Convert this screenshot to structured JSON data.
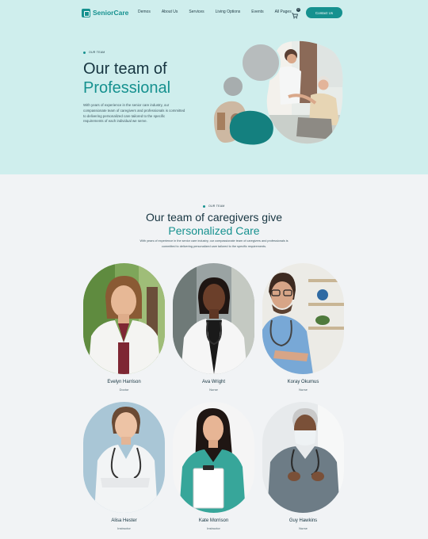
{
  "header": {
    "logo_text": "SeniorCare",
    "nav": [
      "Demos",
      "About Us",
      "Services",
      "Living Options",
      "Events",
      "All Pages"
    ],
    "cart_count": "0",
    "contact_label": "Contact Us"
  },
  "hero": {
    "eyebrow": "OUR TEAM",
    "title_line1": "Our team of",
    "title_line2": "Professional",
    "description": "With years of experience in the senior care industry, our compassionate team of caregivers and professionals is committed to delivering personalized care tailored to the specific requirements of each individual we serve."
  },
  "team": {
    "eyebrow": "OUR TEAM",
    "title_line1": "Our team of caregivers give",
    "title_line2": "Personalized Care",
    "description": "With years of experience in the senior care industry, our compassionate team of caregivers and professionals is committed to delivering personalized care tailored to the specific requirements.",
    "members": [
      {
        "name": "Evelyn Harrison",
        "role": "Doctor"
      },
      {
        "name": "Ava Wright",
        "role": "Nurse"
      },
      {
        "name": "Koray Okumus",
        "role": "Nurse"
      },
      {
        "name": "Alisa Hester",
        "role": "Instructor"
      },
      {
        "name": "Kate Morrison",
        "role": "Instructor"
      },
      {
        "name": "Guy Hawkins",
        "role": "Nurse"
      }
    ]
  },
  "colors": {
    "accent": "#16918f",
    "hero_background": "#cfeeed",
    "page_background": "#f1f3f5",
    "heading": "#163440"
  }
}
